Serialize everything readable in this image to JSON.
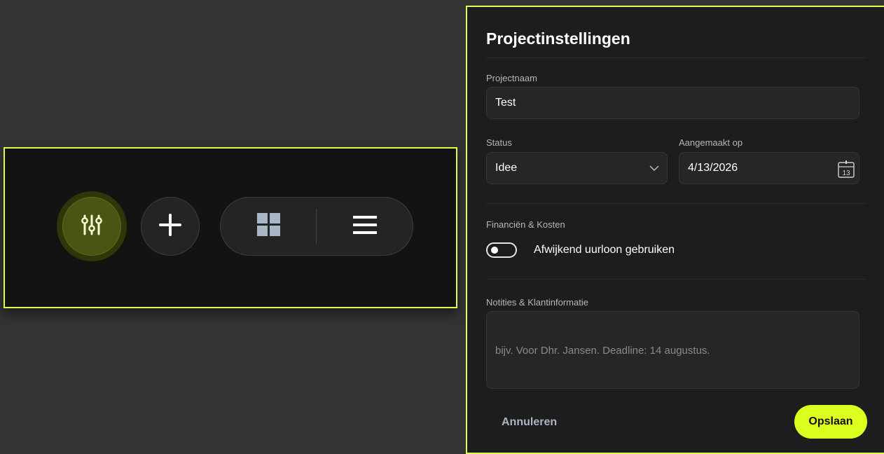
{
  "toolbar": {
    "filter_icon": "sliders-icon",
    "add_icon": "plus-icon",
    "grid_icon": "grid-view-icon",
    "list_icon": "list-view-icon",
    "accent_color": "#ddff4a"
  },
  "dialog": {
    "title": "Projectinstellingen",
    "project_name": {
      "label": "Projectnaam",
      "value": "Test"
    },
    "status": {
      "label": "Status",
      "value": "Idee"
    },
    "created": {
      "label": "Aangemaakt op",
      "value": "4/13/2026",
      "calendar_day": "13"
    },
    "finance": {
      "section_label": "Financiën & Kosten",
      "toggle_label": "Afwijkend uurloon gebruiken",
      "toggle_on": false
    },
    "notes": {
      "label": "Notities & Klantinformatie",
      "placeholder": "bijv. Voor Dhr. Jansen. Deadline: 14 augustus."
    },
    "cancel_label": "Annuleren",
    "save_label": "Opslaan",
    "save_color": "#dcff1f"
  }
}
